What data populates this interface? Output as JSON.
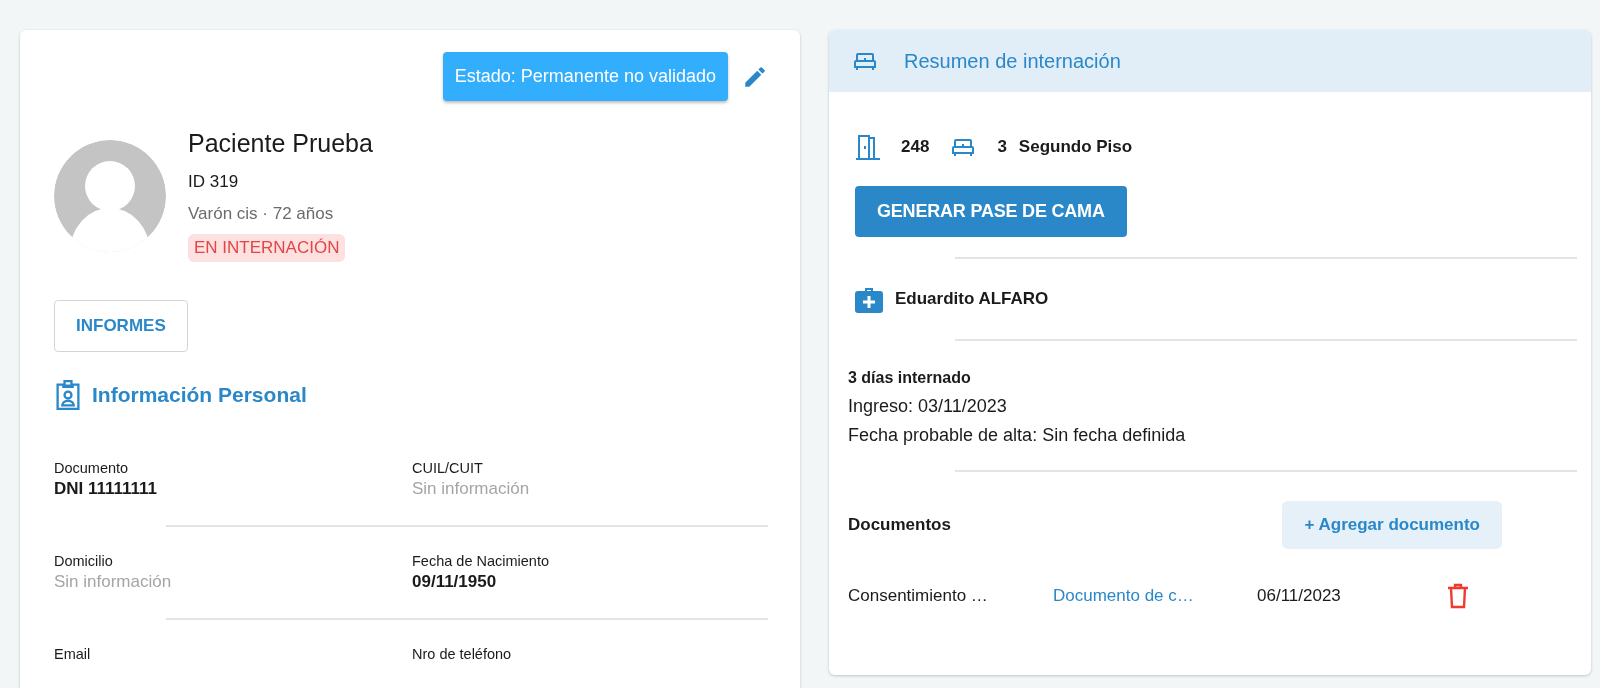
{
  "status_button": {
    "label": "Estado: Permanente no validado"
  },
  "patient": {
    "name": "Paciente Prueba",
    "id": "ID 319",
    "details": "Varón cis · 72 años",
    "status_badge": "EN INTERNACIÓN"
  },
  "reports_button": {
    "label": "INFORMES"
  },
  "personal_info": {
    "title": "Información Personal",
    "fields": [
      {
        "label": "Documento",
        "value": "DNI 11111111",
        "missing": false
      },
      {
        "label": "CUIL/CUIT",
        "value": "Sin información",
        "missing": true
      },
      {
        "label": "Domicilio",
        "value": "Sin información",
        "missing": true
      },
      {
        "label": "Fecha de Nacimiento",
        "value": "09/11/1950",
        "missing": false
      },
      {
        "label": "Email"
      },
      {
        "label": "Nro de teléfono"
      }
    ]
  },
  "summary": {
    "title": "Resumen de internación",
    "room": "248",
    "bed": "3",
    "floor": "Segundo Piso",
    "bed_pass_button": "GENERAR PASE DE CAMA",
    "doctor": "Eduardito ALFARO",
    "days": "3 días internado",
    "admission": "Ingreso: 03/11/2023",
    "discharge": "Fecha probable de alta: Sin fecha definida",
    "documents": {
      "title": "Documentos",
      "add_button": "+ Agregar documento",
      "items": [
        {
          "type": "Consentimiento …",
          "name": "Documento de c…",
          "date": "06/11/2023"
        }
      ]
    }
  }
}
